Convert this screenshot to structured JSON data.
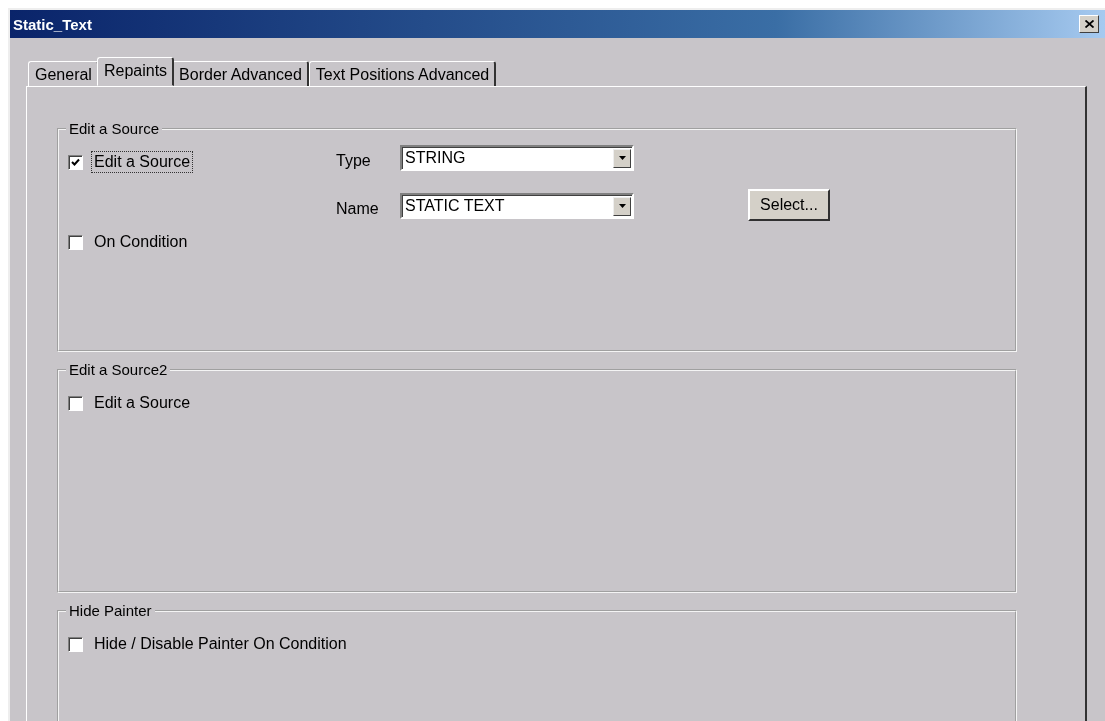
{
  "window": {
    "title": "Static_Text"
  },
  "tabs": [
    {
      "label": "General",
      "selected": false
    },
    {
      "label": "Repaints",
      "selected": true
    },
    {
      "label": "Border Advanced",
      "selected": false
    },
    {
      "label": "Text Positions Advanced",
      "selected": false
    }
  ],
  "groups": [
    {
      "legend": "Edit a Source",
      "checkboxes": [
        {
          "label": "Edit a Source",
          "checked": true,
          "focused": true
        },
        {
          "label": "On Condition",
          "checked": false,
          "focused": false
        }
      ],
      "fields": [
        {
          "label": "Type",
          "value": "STRING"
        },
        {
          "label": "Name",
          "value": "STATIC TEXT"
        }
      ],
      "button": "Select..."
    },
    {
      "legend": "Edit a Source2",
      "checkboxes": [
        {
          "label": "Edit a Source",
          "checked": false,
          "focused": false
        }
      ]
    },
    {
      "legend": "Hide Painter",
      "checkboxes": [
        {
          "label": "Hide / Disable Painter On Condition",
          "checked": false,
          "focused": false
        }
      ]
    }
  ]
}
